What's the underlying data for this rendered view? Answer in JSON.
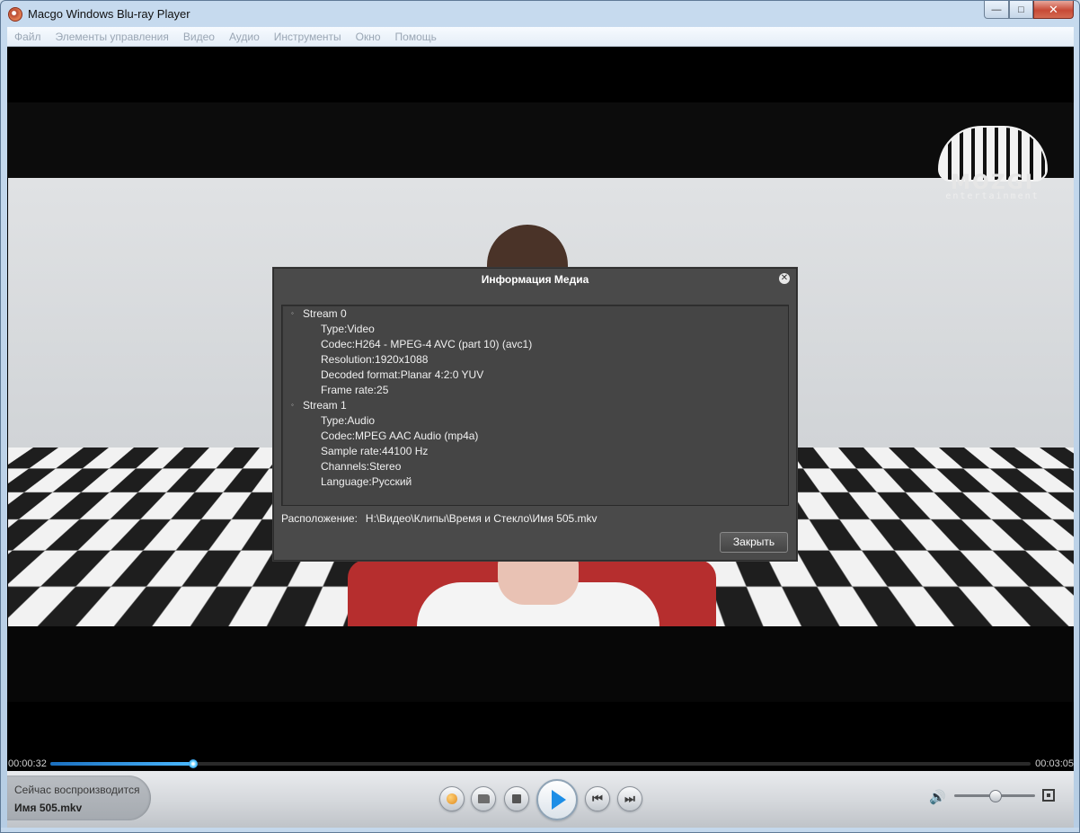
{
  "window": {
    "title": "Macgo Windows Blu-ray Player",
    "buttons": {
      "minimize": "—",
      "maximize": "□",
      "close": "✕"
    }
  },
  "menu": {
    "items": [
      "Файл",
      "Элементы управления",
      "Видео",
      "Аудио",
      "Инструменты",
      "Окно",
      "Помощь"
    ]
  },
  "video": {
    "logo": {
      "name": "MOZGI",
      "sub": "entertainment"
    }
  },
  "dialog": {
    "title": "Информация Медиа",
    "close_icon": "✕",
    "streams": [
      {
        "label": "Stream 0",
        "fields": [
          "Type:Video",
          "Codec:H264 - MPEG-4 AVC (part 10) (avc1)",
          "Resolution:1920x1088",
          "Decoded format:Planar 4:2:0 YUV",
          "Frame rate:25"
        ]
      },
      {
        "label": "Stream 1",
        "fields": [
          "Type:Audio",
          "Codec:MPEG AAC Audio (mp4a)",
          "Sample rate:44100 Hz",
          "Channels:Stereo",
          "Language:Русский"
        ]
      }
    ],
    "location_label": "Расположение:",
    "location_path": "H:\\Видео\\Клипы\\Время и Стекло\\Имя 505.mkv",
    "close_button": "Закрыть"
  },
  "playback": {
    "current_time": "00:00:32",
    "total_time": "00:03:05",
    "progress_fraction": 0.1459,
    "volume_fraction": 0.5
  },
  "now_playing": {
    "label": "Сейчас воспроизводится",
    "file": "Имя 505.mkv"
  },
  "controls": {
    "icons": [
      "people-icon",
      "open-folder-icon",
      "stop-icon",
      "play-icon",
      "previous-icon",
      "next-icon",
      "volume-icon",
      "fullscreen-icon"
    ]
  },
  "colors": {
    "accent": "#1d8ee6",
    "dialog_bg": "#4a4a4a",
    "progress_fill": "#4ab8ff"
  }
}
